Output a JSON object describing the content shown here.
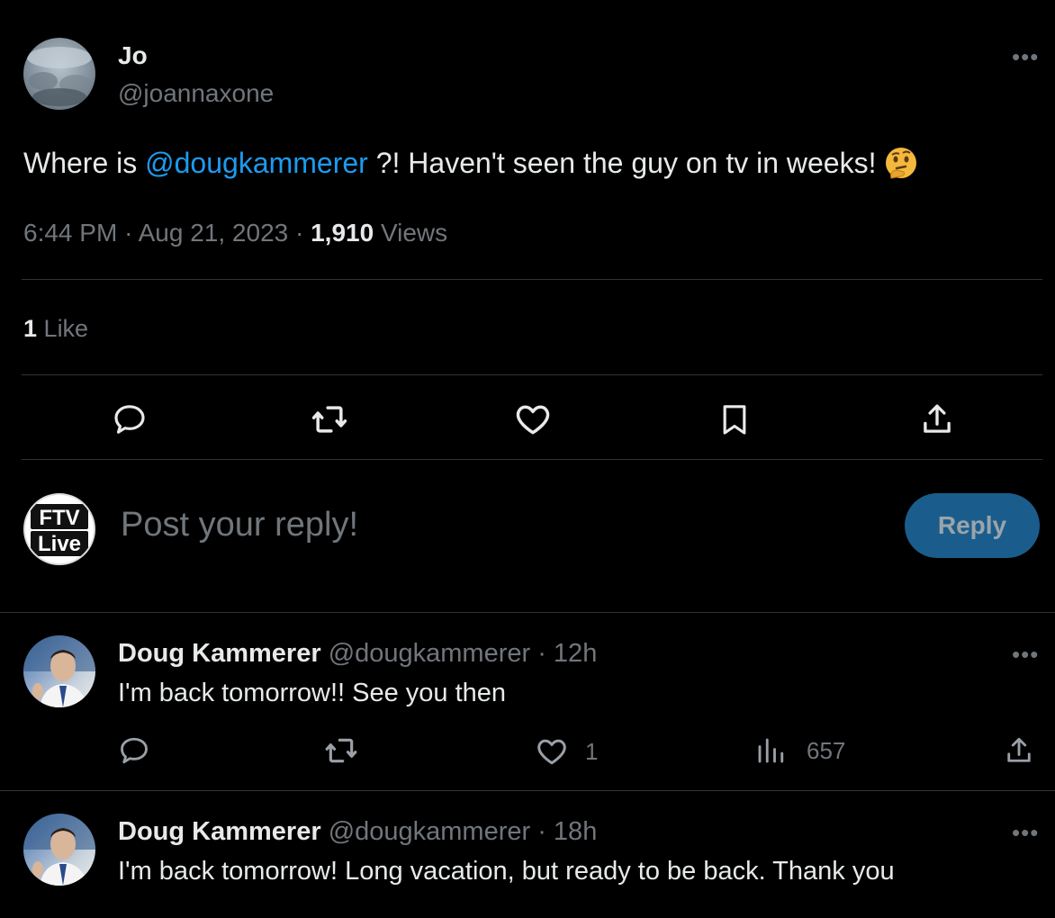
{
  "tweet": {
    "display_name": "Jo",
    "handle": "@joannaxone",
    "text_before": "Where is ",
    "mention": "@dougkammerer",
    "text_after": " ?! Haven't seen the guy on tv in weeks!",
    "emoji": "🤔",
    "time": "6:44 PM",
    "date": "Aug 21, 2023",
    "separator": "·",
    "views_count": "1,910",
    "views_label": "Views",
    "likes_count": "1",
    "likes_label": "Like"
  },
  "composer": {
    "avatar_text_top": "FTV",
    "avatar_text_bottom": "Live",
    "placeholder": "Post your reply!",
    "reply_label": "Reply"
  },
  "replies": [
    {
      "name": "Doug Kammerer",
      "handle": "@dougkammerer",
      "time": "· 12h",
      "text": "I'm back tomorrow!! See you then",
      "likes": "1",
      "views": "657"
    },
    {
      "name": "Doug Kammerer",
      "handle": "@dougkammerer",
      "time": "· 18h",
      "text": "I'm back tomorrow! Long vacation, but ready to be back. Thank you"
    }
  ],
  "colors": {
    "background": "#000000",
    "text": "#e7e9ea",
    "secondary": "#71767b",
    "link": "#1d9bf0",
    "reply_button": "#1a5d8c",
    "divider": "#2f3336"
  }
}
